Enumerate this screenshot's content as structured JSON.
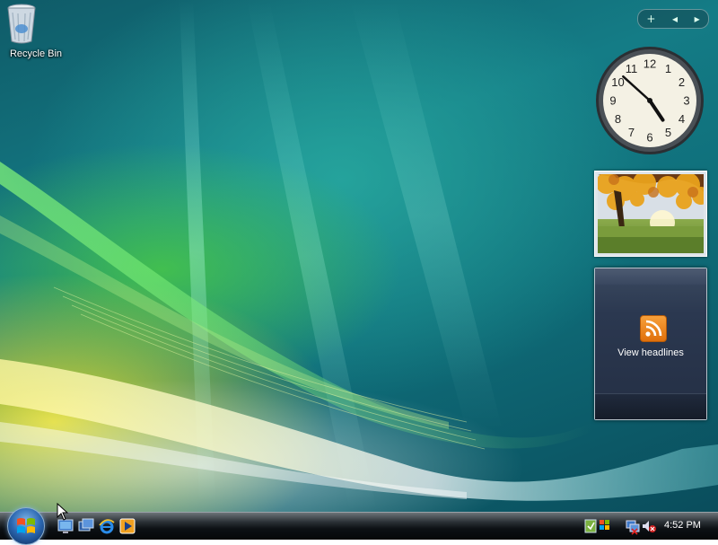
{
  "desktop": {
    "icons": [
      {
        "label": "Recycle Bin",
        "icon": "recycle-bin-icon"
      }
    ]
  },
  "sidebar": {
    "controls": {
      "add": "+",
      "prev": "◂",
      "next": "▸"
    },
    "clock": {
      "hour": 4,
      "minute": 52,
      "numerals": [
        "12",
        "1",
        "2",
        "3",
        "4",
        "5",
        "6",
        "7",
        "8",
        "9",
        "10",
        "11"
      ]
    },
    "slideshow": {
      "subject": "autumn-tree-photo"
    },
    "feeds": {
      "label": "View headlines",
      "icon": "rss-icon"
    }
  },
  "taskbar": {
    "start": "start-orb",
    "quick_launch": [
      "show-desktop-icon",
      "switch-windows-icon",
      "internet-explorer-icon",
      "media-player-icon"
    ],
    "tray_icons": [
      "windows-defender-icon",
      "windows-update-icon",
      "network-icon",
      "volume-muted-icon"
    ],
    "time": "4:52 PM"
  },
  "colors": {
    "accent_start": "#2a66b0",
    "feeds_rss": "#f08a1c",
    "taskbar": "#0c1014"
  }
}
